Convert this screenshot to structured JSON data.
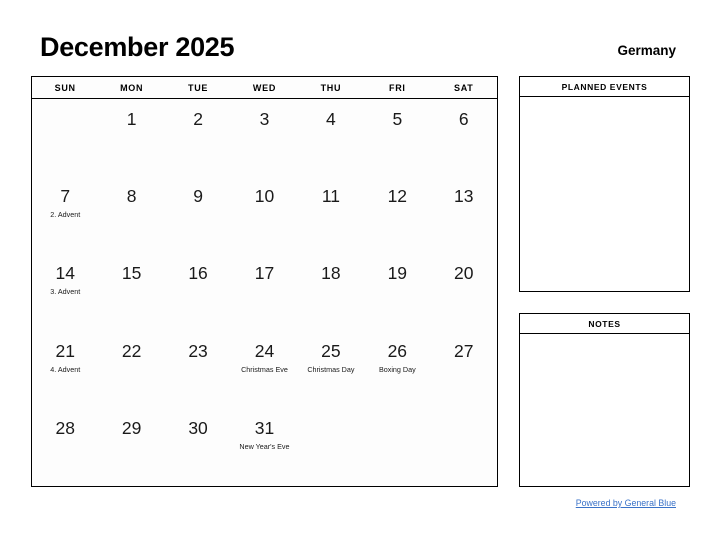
{
  "header": {
    "title": "December 2025",
    "country": "Germany"
  },
  "calendar": {
    "weekdays": [
      "SUN",
      "MON",
      "TUE",
      "WED",
      "THU",
      "FRI",
      "SAT"
    ],
    "weeks": [
      [
        {
          "day": "",
          "event": ""
        },
        {
          "day": "1",
          "event": ""
        },
        {
          "day": "2",
          "event": ""
        },
        {
          "day": "3",
          "event": ""
        },
        {
          "day": "4",
          "event": ""
        },
        {
          "day": "5",
          "event": ""
        },
        {
          "day": "6",
          "event": ""
        }
      ],
      [
        {
          "day": "7",
          "event": "2. Advent"
        },
        {
          "day": "8",
          "event": ""
        },
        {
          "day": "9",
          "event": ""
        },
        {
          "day": "10",
          "event": ""
        },
        {
          "day": "11",
          "event": ""
        },
        {
          "day": "12",
          "event": ""
        },
        {
          "day": "13",
          "event": ""
        }
      ],
      [
        {
          "day": "14",
          "event": "3. Advent"
        },
        {
          "day": "15",
          "event": ""
        },
        {
          "day": "16",
          "event": ""
        },
        {
          "day": "17",
          "event": ""
        },
        {
          "day": "18",
          "event": ""
        },
        {
          "day": "19",
          "event": ""
        },
        {
          "day": "20",
          "event": ""
        }
      ],
      [
        {
          "day": "21",
          "event": "4. Advent"
        },
        {
          "day": "22",
          "event": ""
        },
        {
          "day": "23",
          "event": ""
        },
        {
          "day": "24",
          "event": "Christmas Eve"
        },
        {
          "day": "25",
          "event": "Christmas Day"
        },
        {
          "day": "26",
          "event": "Boxing Day"
        },
        {
          "day": "27",
          "event": ""
        }
      ],
      [
        {
          "day": "28",
          "event": ""
        },
        {
          "day": "29",
          "event": ""
        },
        {
          "day": "30",
          "event": ""
        },
        {
          "day": "31",
          "event": "New Year's Eve"
        },
        {
          "day": "",
          "event": ""
        },
        {
          "day": "",
          "event": ""
        },
        {
          "day": "",
          "event": ""
        }
      ]
    ]
  },
  "panels": {
    "planned_events": {
      "title": "PLANNED EVENTS"
    },
    "notes": {
      "title": "NOTES"
    }
  },
  "footer": {
    "link_text": "Powered by General Blue"
  },
  "colors": {
    "link": "#3a72c8",
    "border": "#000000",
    "text": "#000000"
  }
}
